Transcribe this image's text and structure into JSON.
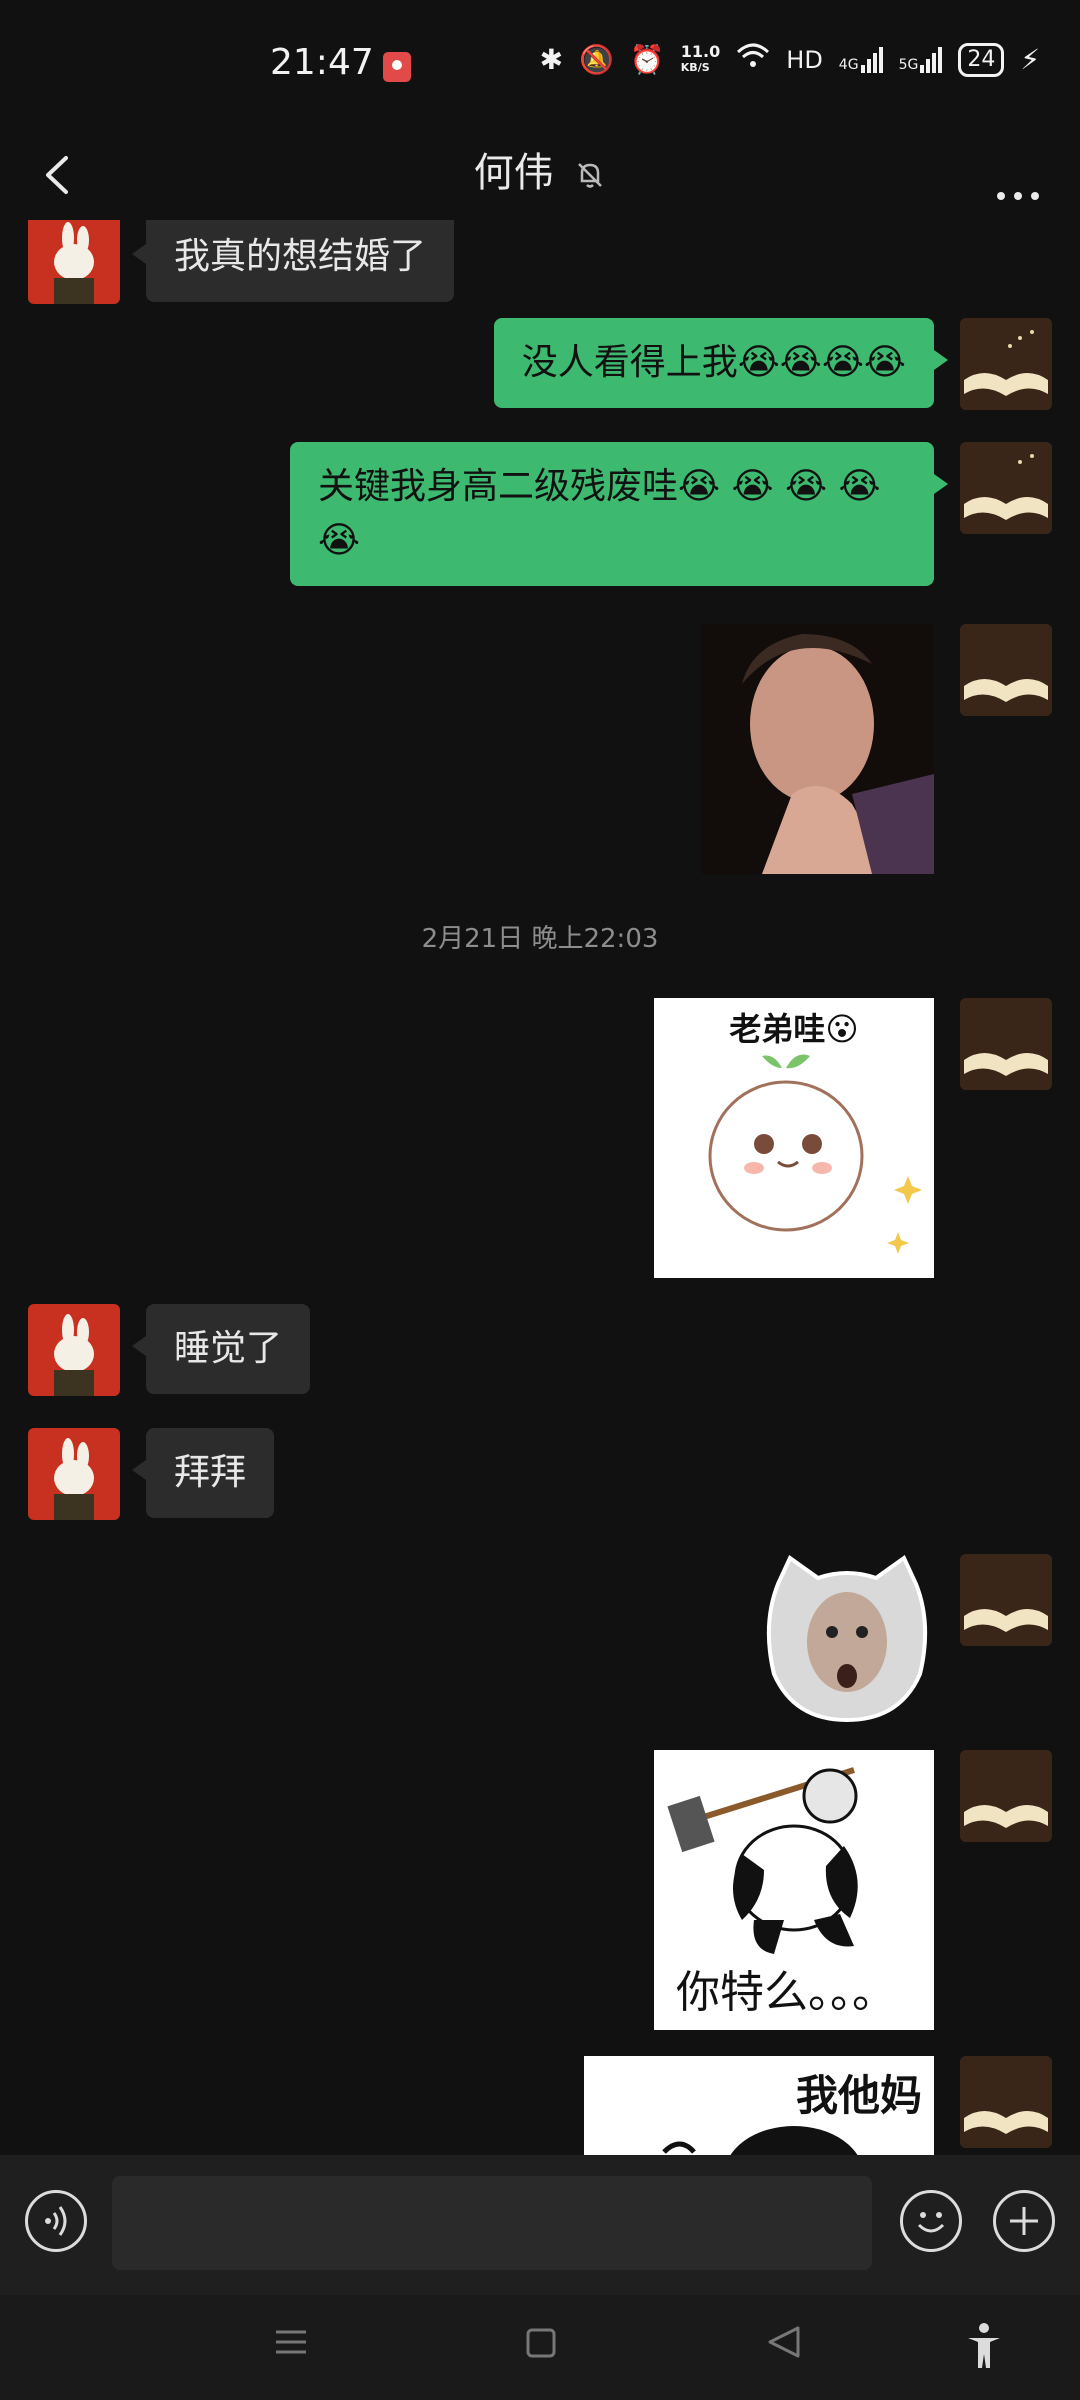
{
  "status_bar": {
    "time": "21:47",
    "net_speed_value": "11.0",
    "net_speed_unit": "KB/S",
    "hd": "HD",
    "signal1": "4G",
    "signal2": "5G",
    "battery": "24"
  },
  "header": {
    "contact_name": "何伟",
    "muted_icon": "bell-off-icon",
    "back_icon": "chevron-left-icon",
    "more_icon": "more-horizontal-icon"
  },
  "messages": [
    {
      "side": "left",
      "type": "text",
      "text": "我真的想结婚了"
    },
    {
      "side": "right",
      "type": "text",
      "text": "没人看得上我😭😭😭😭"
    },
    {
      "side": "right",
      "type": "text",
      "text": "关键我身高二级残废哇😭 😭 😭 😭 😭"
    },
    {
      "side": "right",
      "type": "image",
      "image": "man-portrait-photo"
    },
    {
      "type": "timestamp",
      "text": "2月21日 晚上22:03"
    },
    {
      "side": "right",
      "type": "sticker",
      "caption": "老弟哇😮",
      "image": "sprout-bun-sticker"
    },
    {
      "side": "left",
      "type": "text",
      "text": "睡觉了"
    },
    {
      "side": "left",
      "type": "text",
      "text": "拜拜"
    },
    {
      "side": "right",
      "type": "sticker",
      "image": "shocked-face-cat-sticker"
    },
    {
      "side": "right",
      "type": "sticker",
      "caption": "你特么。。。",
      "image": "panda-hammer-sticker"
    },
    {
      "side": "right",
      "type": "sticker",
      "caption": "我他妈",
      "image": "panda-meme-sticker"
    }
  ],
  "input_bar": {
    "voice_icon": "voice-icon",
    "input_value": "",
    "emoji_icon": "emoji-icon",
    "plus_icon": "plus-icon"
  },
  "nav_bar": {
    "menu_icon": "menu-icon",
    "home_icon": "home-square-icon",
    "back_icon": "back-triangle-icon",
    "accessibility_icon": "accessibility-icon"
  },
  "colors": {
    "background": "#111111",
    "bubble_sent": "#3dba6f",
    "bubble_received": "#2c2c2c"
  }
}
